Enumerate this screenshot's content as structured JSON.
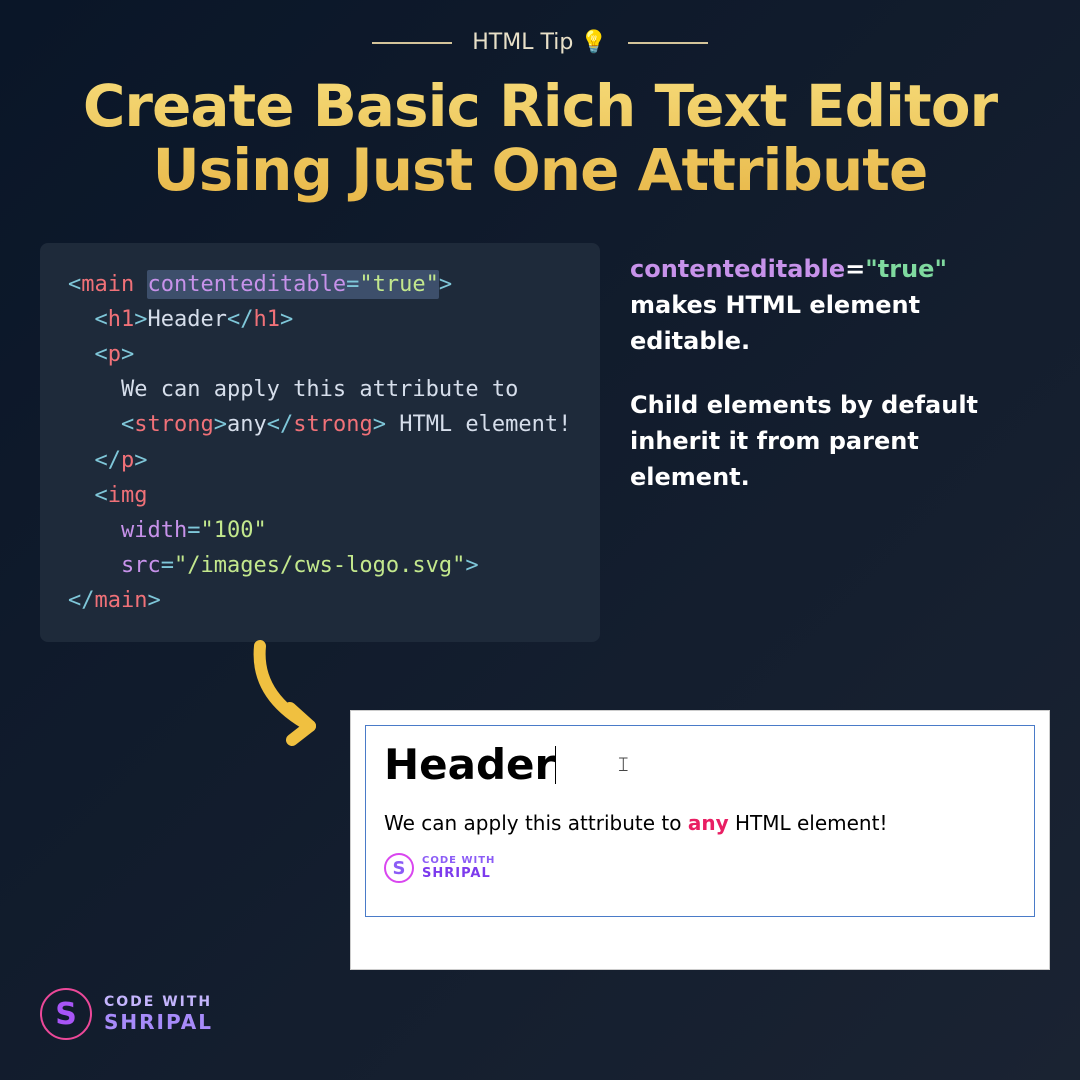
{
  "header": {
    "tag": "HTML Tip",
    "emoji": "💡",
    "title_line1": "Create Basic Rich Text Editor",
    "title_line2": "Using Just One Attribute"
  },
  "code": {
    "l1_open": "<",
    "l1_tag": "main",
    "l1_attr": "contenteditable",
    "l1_eq": "=",
    "l1_val": "\"true\"",
    "l1_close": ">",
    "l2_open": "<",
    "l2_tag": "h1",
    "l2_close": ">",
    "l2_text": "Header",
    "l2_end_open": "</",
    "l2_end_tag": "h1",
    "l2_end_close": ">",
    "l3_open": "<",
    "l3_tag": "p",
    "l3_close": ">",
    "l4_text": "We can apply this attribute to",
    "l5_open": "<",
    "l5_tag": "strong",
    "l5_close": ">",
    "l5_text": "any",
    "l5_end_open": "</",
    "l5_end_tag": "strong",
    "l5_end_close": ">",
    "l5_rest": " HTML element!",
    "l6_open": "</",
    "l6_tag": "p",
    "l6_close": ">",
    "l7_open": "<",
    "l7_tag": "img",
    "l8_attr": "width",
    "l8_eq": "=",
    "l8_val": "\"100\"",
    "l9_attr": "src",
    "l9_eq": "=",
    "l9_val": "\"/images/cws-logo.svg\"",
    "l9_close": ">",
    "l10_open": "</",
    "l10_tag": "main",
    "l10_close": ">"
  },
  "explain": {
    "attr": "contenteditable",
    "eq": "=",
    "val": "\"true\"",
    "p1_rest": " makes HTML element editable.",
    "p2": "Child elements by default inherit it from parent element."
  },
  "preview": {
    "header": "Header",
    "text_before": "We can apply this attribute to ",
    "strong": "any",
    "text_after": " HTML element!"
  },
  "logo": {
    "letter": "S",
    "line1": "CODE WITH",
    "line2": "SHRIPAL"
  }
}
